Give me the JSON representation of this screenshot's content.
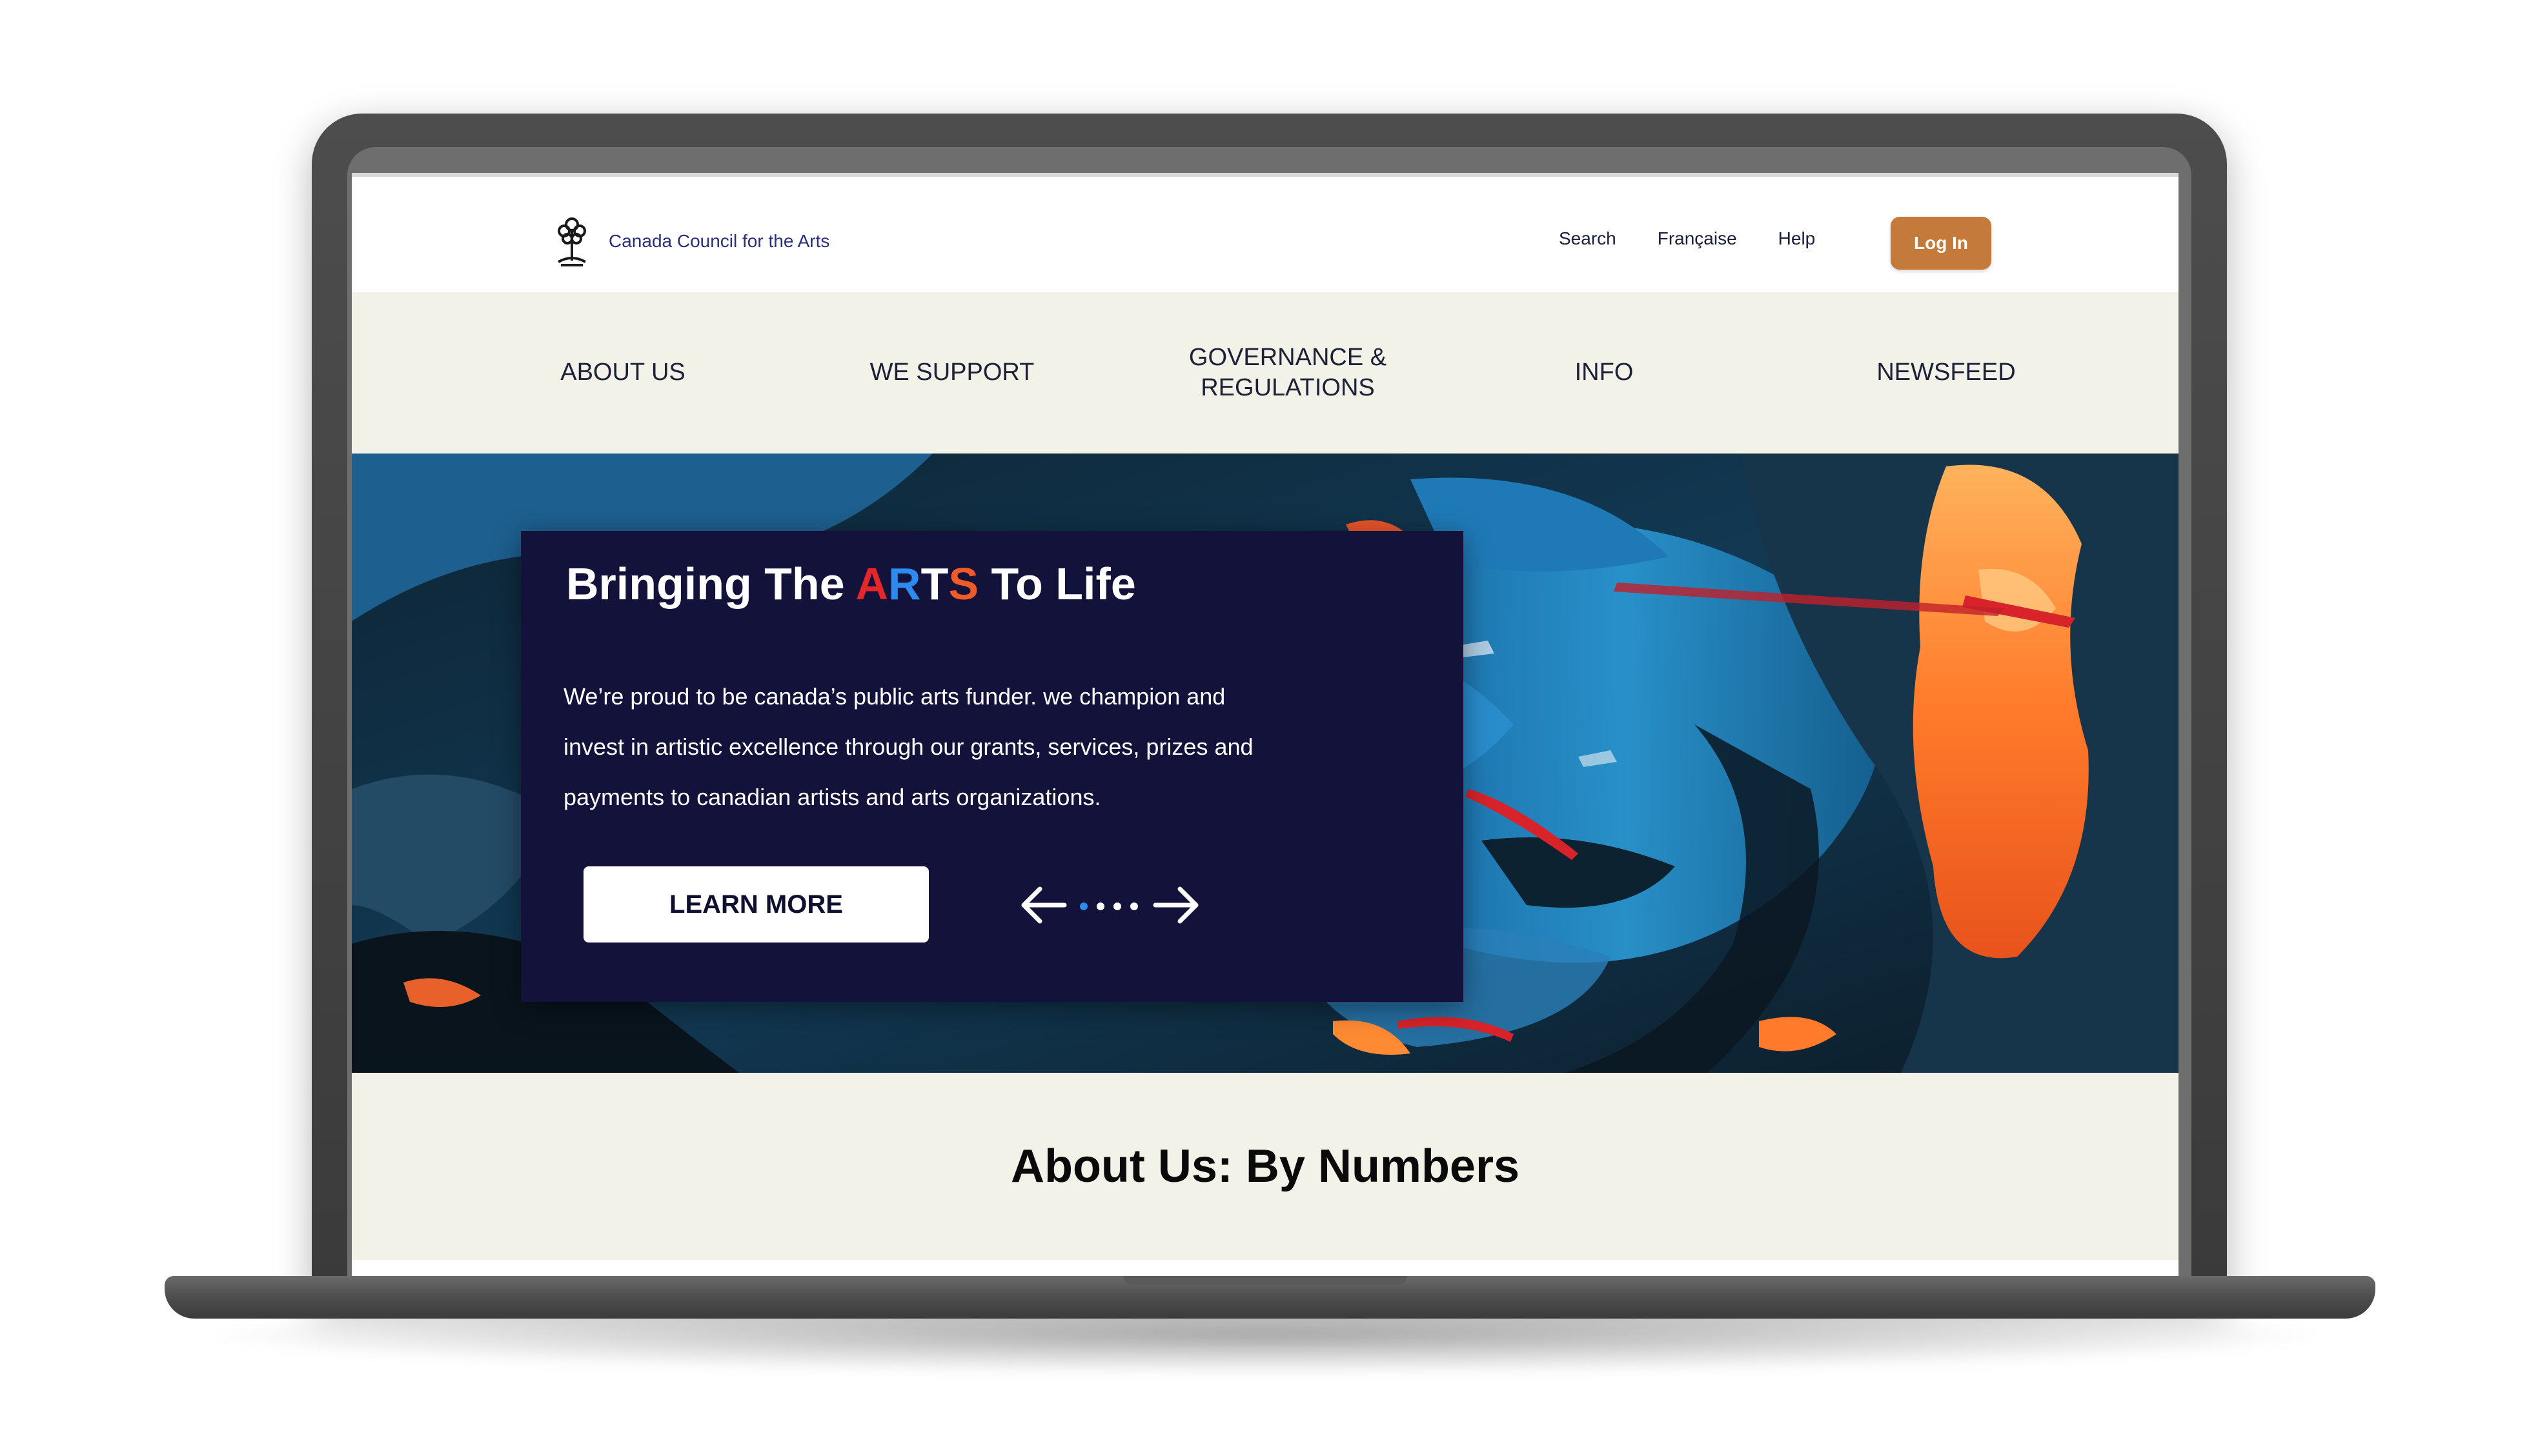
{
  "site": {
    "brand_name": "Canada Council for the Arts",
    "logo_icon": "tree-icon",
    "accent_color": "#c47a3a",
    "navy_color": "#12123a"
  },
  "header": {
    "links": [
      "Search",
      "Française",
      "Help"
    ],
    "login_label": "Log In"
  },
  "nav": {
    "items": [
      {
        "label": "ABOUT US"
      },
      {
        "label": "WE SUPPORT"
      },
      {
        "label_line1": "GOVERNANCE &",
        "label_line2": "REGULATIONS"
      },
      {
        "label": "INFO"
      },
      {
        "label": "NEWSFEED"
      }
    ]
  },
  "hero": {
    "title_before": "Bringing The ",
    "title_arts": [
      "A",
      "R",
      "T",
      "S"
    ],
    "title_after": " To Life",
    "body": "We’re proud to be canada’s public arts funder. we champion and invest in artistic excellence through our grants, services, prizes and payments to canadian artists and arts organizations.",
    "button_label": "LEARN MORE",
    "carousel": {
      "slides": 4,
      "active_slide": 1,
      "active_color": "#2d8bf0"
    }
  },
  "numbers": {
    "title": "About Us: By Numbers"
  }
}
